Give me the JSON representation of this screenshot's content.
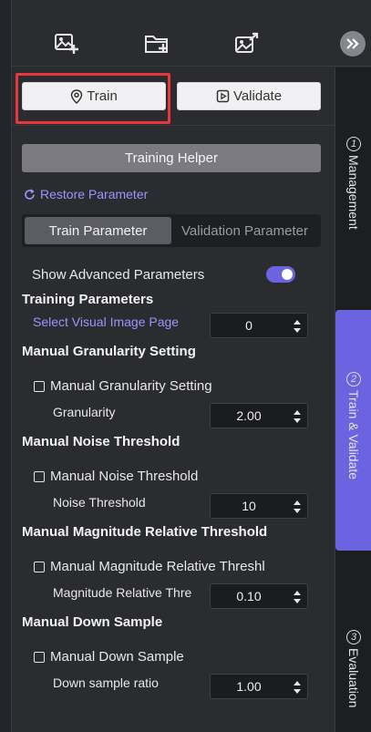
{
  "toolbar": {
    "icons": [
      "add-image-icon",
      "add-folder-icon",
      "export-image-icon",
      "collapse-chevrons-icon"
    ]
  },
  "actions": {
    "train_label": "Train",
    "validate_label": "Validate",
    "helper_label": "Training Helper",
    "restore_label": "Restore Parameter"
  },
  "tabs": {
    "train": "Train Parameter",
    "validation": "Validation Parameter",
    "active": "Train Parameter"
  },
  "advanced": {
    "label": "Show Advanced Parameters",
    "enabled": true
  },
  "training": {
    "heading": "Training Parameters",
    "visual_page_label": "Select Visual Image Page",
    "visual_page_value": "0"
  },
  "granularity": {
    "heading": "Manual Granularity Setting",
    "checkbox_label": "Manual Granularity Setting",
    "field_label": "Granularity",
    "value": "2.00"
  },
  "noise": {
    "heading": "Manual Noise Threshold",
    "checkbox_label": "Manual Noise Threshold",
    "field_label": "Noise Threshold",
    "value": "10"
  },
  "magnitude": {
    "heading": "Manual Magnitude Relative Threshold",
    "checkbox_label": "Manual Magnitude Relative Threshl",
    "field_label": "Magnitude Relative Thre",
    "value": "0.10"
  },
  "downsample": {
    "heading": "Manual Down Sample",
    "checkbox_label": "Manual Down Sample",
    "field_label": "Down sample ratio",
    "value": "1.00"
  },
  "rail": {
    "tabs": [
      {
        "num": "1",
        "label": "Management"
      },
      {
        "num": "2",
        "label": "Train & Validate"
      },
      {
        "num": "3",
        "label": "Evaluation"
      }
    ],
    "active_index": 1
  },
  "colors": {
    "accent": "#6b63e0",
    "highlight": "#e8383b",
    "link": "#9c93ff"
  }
}
